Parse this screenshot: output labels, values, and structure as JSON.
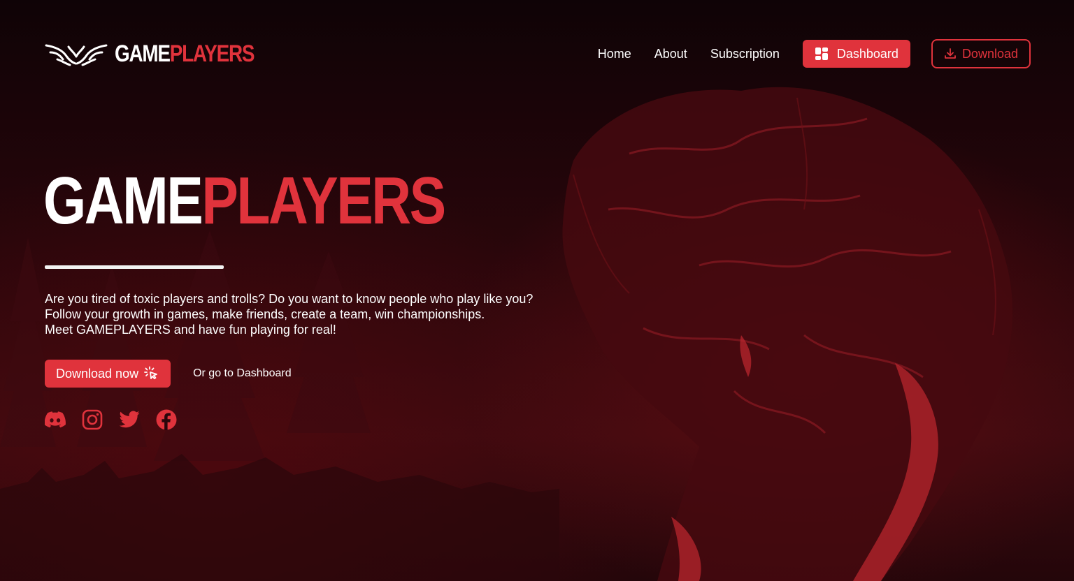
{
  "brand": {
    "part1": "GAME",
    "part2": "PLAYERS"
  },
  "nav": {
    "links": [
      "Home",
      "About",
      "Subscription"
    ],
    "dashboard_label": "Dashboard",
    "download_label": "Download"
  },
  "hero": {
    "title_part1": "GAME",
    "title_part2": "PLAYERS",
    "lines": [
      "Are you tired of toxic players and trolls? Do you want to know people who play like you?",
      "Follow your growth in games, make friends, create a team, win championships.",
      "Meet GAMEPLAYERS and have fun playing for real!"
    ],
    "cta_primary": "Download now",
    "cta_secondary": "Or go to Dashboard"
  },
  "socials": [
    "discord-icon",
    "instagram-icon",
    "twitter-icon",
    "facebook-icon"
  ],
  "colors": {
    "accent": "#e0333c",
    "background": "#1a0508",
    "text": "#ffffff"
  }
}
